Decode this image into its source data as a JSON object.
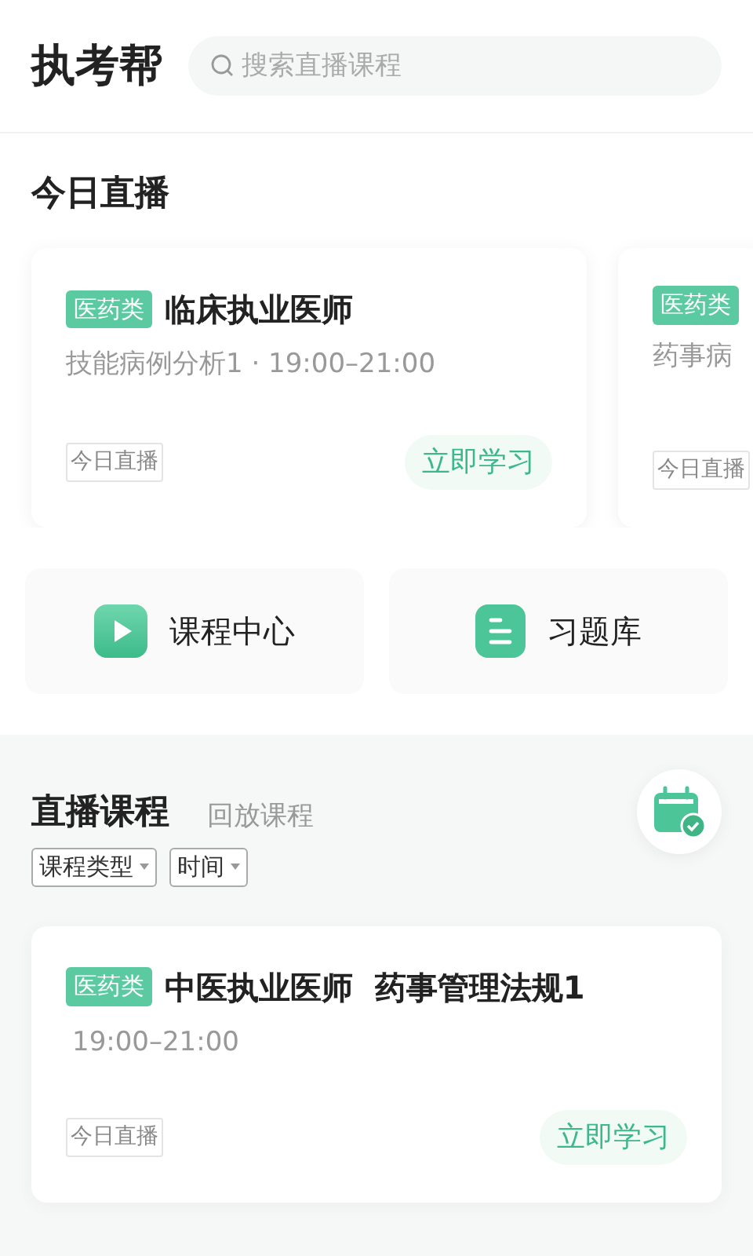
{
  "app_title": "执考帮",
  "search": {
    "placeholder": "搜索直播课程"
  },
  "today_section": {
    "title": "今日直播",
    "cards": [
      {
        "tag": "医药类",
        "title": "临床执业医师",
        "subtitle": "技能病例分析1 · 19:00–21:00",
        "status": "今日直播",
        "action": "立即学习"
      },
      {
        "tag": "医药类",
        "subtitle": "药事病",
        "status": "今日直播"
      }
    ]
  },
  "shortcuts": [
    {
      "kind": "play",
      "label": "课程中心"
    },
    {
      "kind": "list",
      "label": "习题库"
    }
  ],
  "course_tabs": [
    {
      "label": "直播课程",
      "selected": true
    },
    {
      "label": "回放课程",
      "selected": false
    }
  ],
  "filters": [
    "课程类型",
    "时间"
  ],
  "courses": [
    {
      "tag": "医药类",
      "title": "中医执业医师  药事管理法规1",
      "time": "19:00–21:00",
      "status": "今日直播",
      "action": "立即学习"
    }
  ]
}
